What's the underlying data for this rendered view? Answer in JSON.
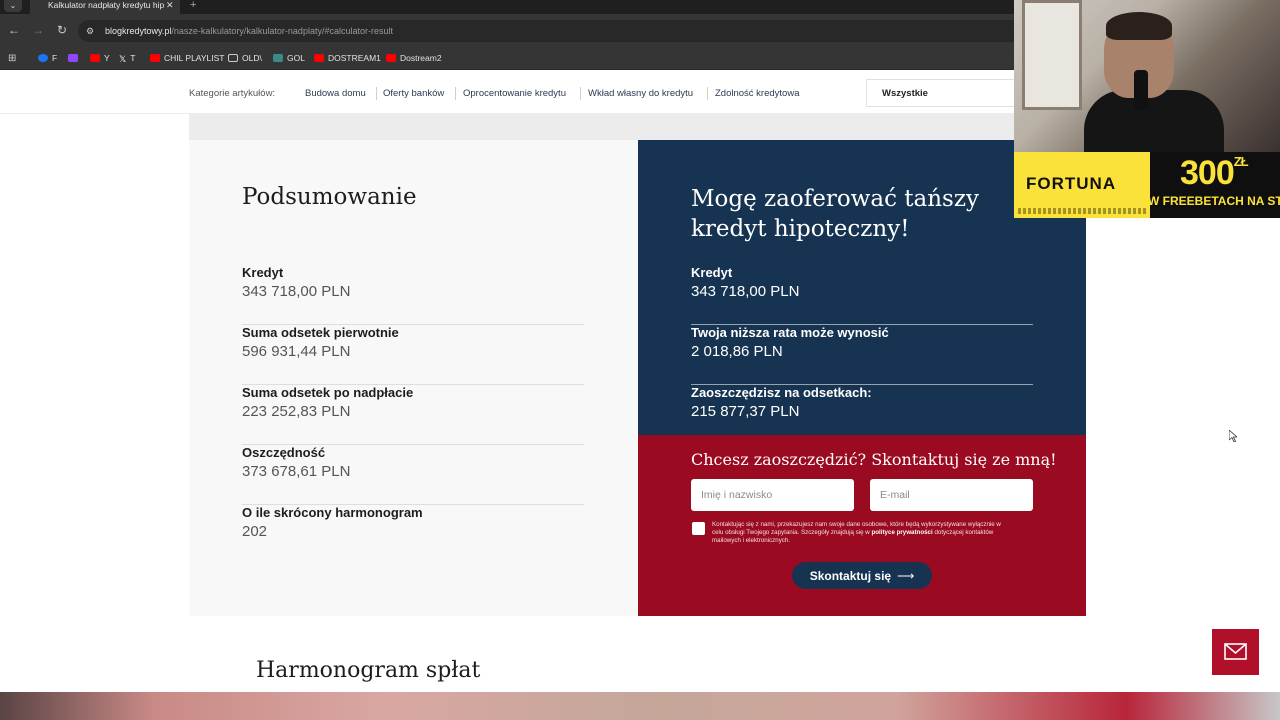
{
  "browser": {
    "tab_title": "Kalkulator nadpłaty kredytu hip",
    "url_host": "blogkredytowy.pl",
    "url_path": "/nasze-kalkulatory/kalkulator-nadplaty/#calculator-result",
    "bookmarks": [
      {
        "label": "F",
        "color": "#1877f2"
      },
      {
        "label": "",
        "color": "#9146ff"
      },
      {
        "label": "Y",
        "color": "#ff0000"
      },
      {
        "label": "T",
        "color": "#ffffff"
      },
      {
        "label": "CHIL PLAYLIST",
        "color": "#ff0000"
      },
      {
        "label": "OLD\\",
        "color": "#cccccc"
      },
      {
        "label": "GOL",
        "color": "#3a8a8a"
      },
      {
        "label": "DOSTREAM1",
        "color": "#ff0000"
      },
      {
        "label": "Dostream2",
        "color": "#ff0000"
      }
    ]
  },
  "categories": {
    "label": "Kategorie artykułów:",
    "links": [
      "Budowa domu",
      "Oferty banków",
      "Oprocentowanie kredytu",
      "Wkład własny do kredytu",
      "Zdolność kredytowa"
    ],
    "select_value": "Wszystkie"
  },
  "summary": {
    "title": "Podsumowanie",
    "items": [
      {
        "label": "Kredyt",
        "value": "343 718,00 PLN"
      },
      {
        "label": "Suma odsetek pierwotnie",
        "value": "596 931,44 PLN"
      },
      {
        "label": "Suma odsetek po nadpłacie",
        "value": "223 252,83 PLN"
      },
      {
        "label": "Oszczędność",
        "value": "373 678,61 PLN"
      },
      {
        "label": "O ile skrócony harmonogram",
        "value": "202"
      }
    ]
  },
  "offer": {
    "title": "Mogę zaoferować tańszy kredyt hipoteczny!",
    "items": [
      {
        "label": "Kredyt",
        "value": "343 718,00 PLN"
      },
      {
        "label": "Twoja niższa rata może wynosić",
        "value": "2 018,86 PLN"
      },
      {
        "label": "Zaoszczędzisz na odsetkach:",
        "value": "215 877,37 PLN"
      }
    ]
  },
  "contact": {
    "title": "Chcesz zaoszczędzić? Skontaktuj się ze mną!",
    "name_placeholder": "Imię i nazwisko",
    "email_placeholder": "E-mail",
    "consent_text": "Kontaktując się z nami, przekazujesz nam swoje dane osobowe, które będą wykorzystywane wyłącznie w celu obsługi Twojego zapytania. Szczegóły znajdują się w",
    "consent_link": "polityce prywatności",
    "consent_tail": "dotyczącej kontaktów mailowych i elektronicznych.",
    "submit_label": "Skontaktuj się",
    "submit_arrow": "⟶"
  },
  "schedule_title": "Harmonogram spłat",
  "ad": {
    "brand": "FORTUNA",
    "amount": "300",
    "currency": "ZŁ",
    "slogan": "W FREEBETACH NA START"
  }
}
